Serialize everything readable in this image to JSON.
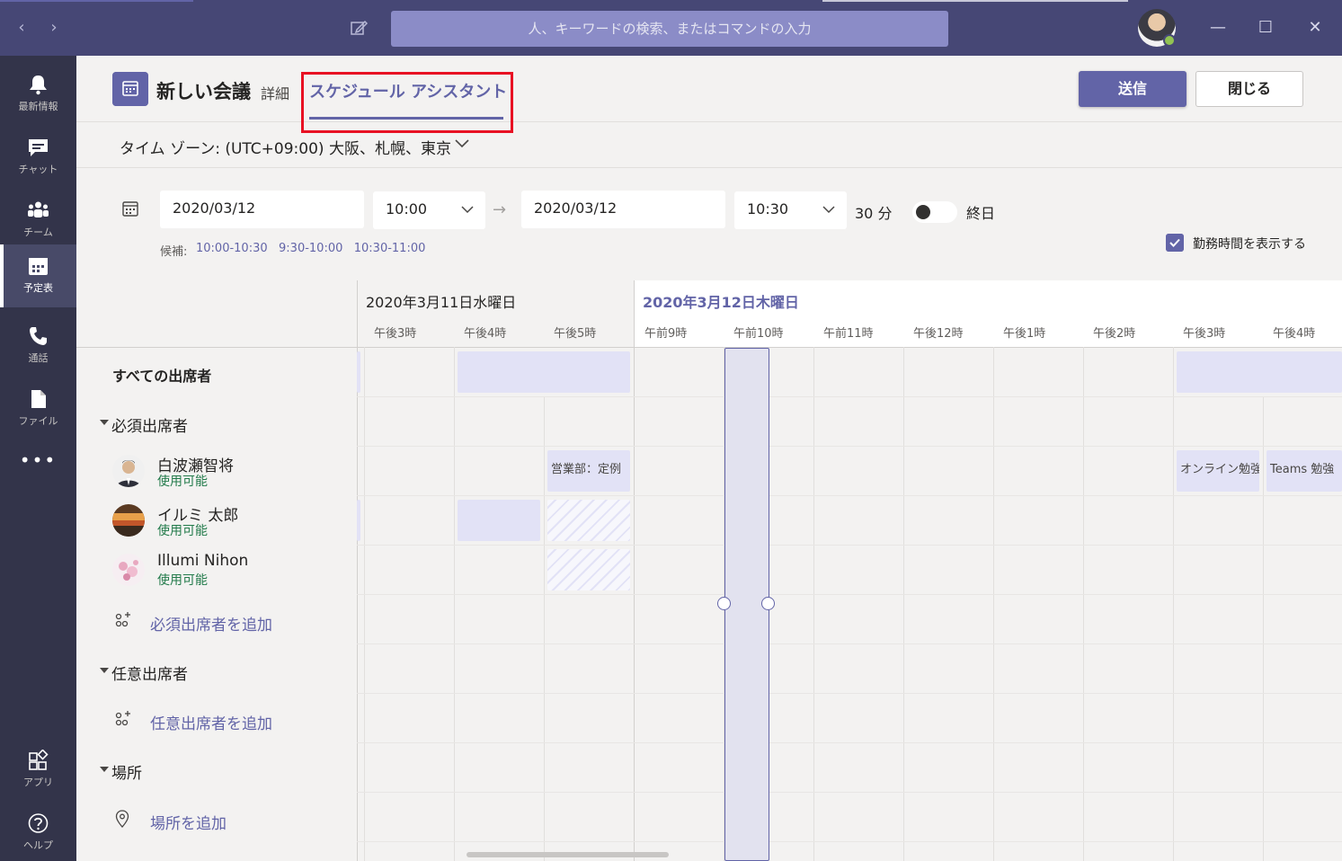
{
  "titlebar": {
    "search_placeholder": "人、キーワードの検索、またはコマンドの入力"
  },
  "rail": {
    "items": [
      {
        "label": "最新情報",
        "icon": "bell-icon"
      },
      {
        "label": "チャット",
        "icon": "chat-icon"
      },
      {
        "label": "チーム",
        "icon": "teams-icon"
      },
      {
        "label": "予定表",
        "icon": "calendar-icon"
      },
      {
        "label": "通話",
        "icon": "phone-icon"
      },
      {
        "label": "ファイル",
        "icon": "file-icon"
      },
      {
        "label": "アプリ",
        "icon": "apps-icon"
      },
      {
        "label": "ヘルプ",
        "icon": "help-icon"
      }
    ],
    "more": "•••"
  },
  "header": {
    "title": "新しい会議",
    "tab_detail": "詳細",
    "tab_assistant": "スケジュール アシスタント",
    "send_label": "送信",
    "close_label": "閉じる"
  },
  "timezone": "タイム ゾーン: (UTC+09:00) 大阪、札幌、東京",
  "datetime": {
    "start_date": "2020/03/12",
    "start_time": "10:00",
    "end_date": "2020/03/12",
    "end_time": "10:30",
    "duration": "30 分",
    "allday_label": "終日",
    "allday_on": false,
    "suggest_label": "候補:",
    "suggest_times": "10:00-10:30   9:30-10:00   10:30-11:00",
    "workhours_label": "勤務時間を表示する",
    "workhours_checked": true
  },
  "grid": {
    "day1": "2020年3月11日水曜日",
    "day2": "2020年3月12日木曜日",
    "hours": [
      "午後3時",
      "午後4時",
      "午後5時",
      "午前9時",
      "午前10時",
      "午前11時",
      "午後12時",
      "午後1時",
      "午後2時",
      "午後3時",
      "午後4時"
    ]
  },
  "attendees": {
    "all_label": "すべての出席者",
    "required_label": "必須出席者",
    "people": [
      {
        "name": "白波瀬智将",
        "status": "使用可能"
      },
      {
        "name": "イルミ 太郎",
        "status": "使用可能"
      },
      {
        "name": "Illumi Nihon",
        "status": "使用可能"
      }
    ],
    "add_required": "必須出席者を追加",
    "optional_label": "任意出席者",
    "add_optional": "任意出席者を追加",
    "location_label": "場所",
    "add_location": "場所を追加"
  },
  "events": {
    "e1": "営業部：定例",
    "e2": "オンライン勉強",
    "e3": "Teams 勉強"
  },
  "colors": {
    "brand": "#6264a7",
    "titlebar": "#464775",
    "rail": "#33344a",
    "available": "#237b4b",
    "highlight": "#e81123"
  }
}
